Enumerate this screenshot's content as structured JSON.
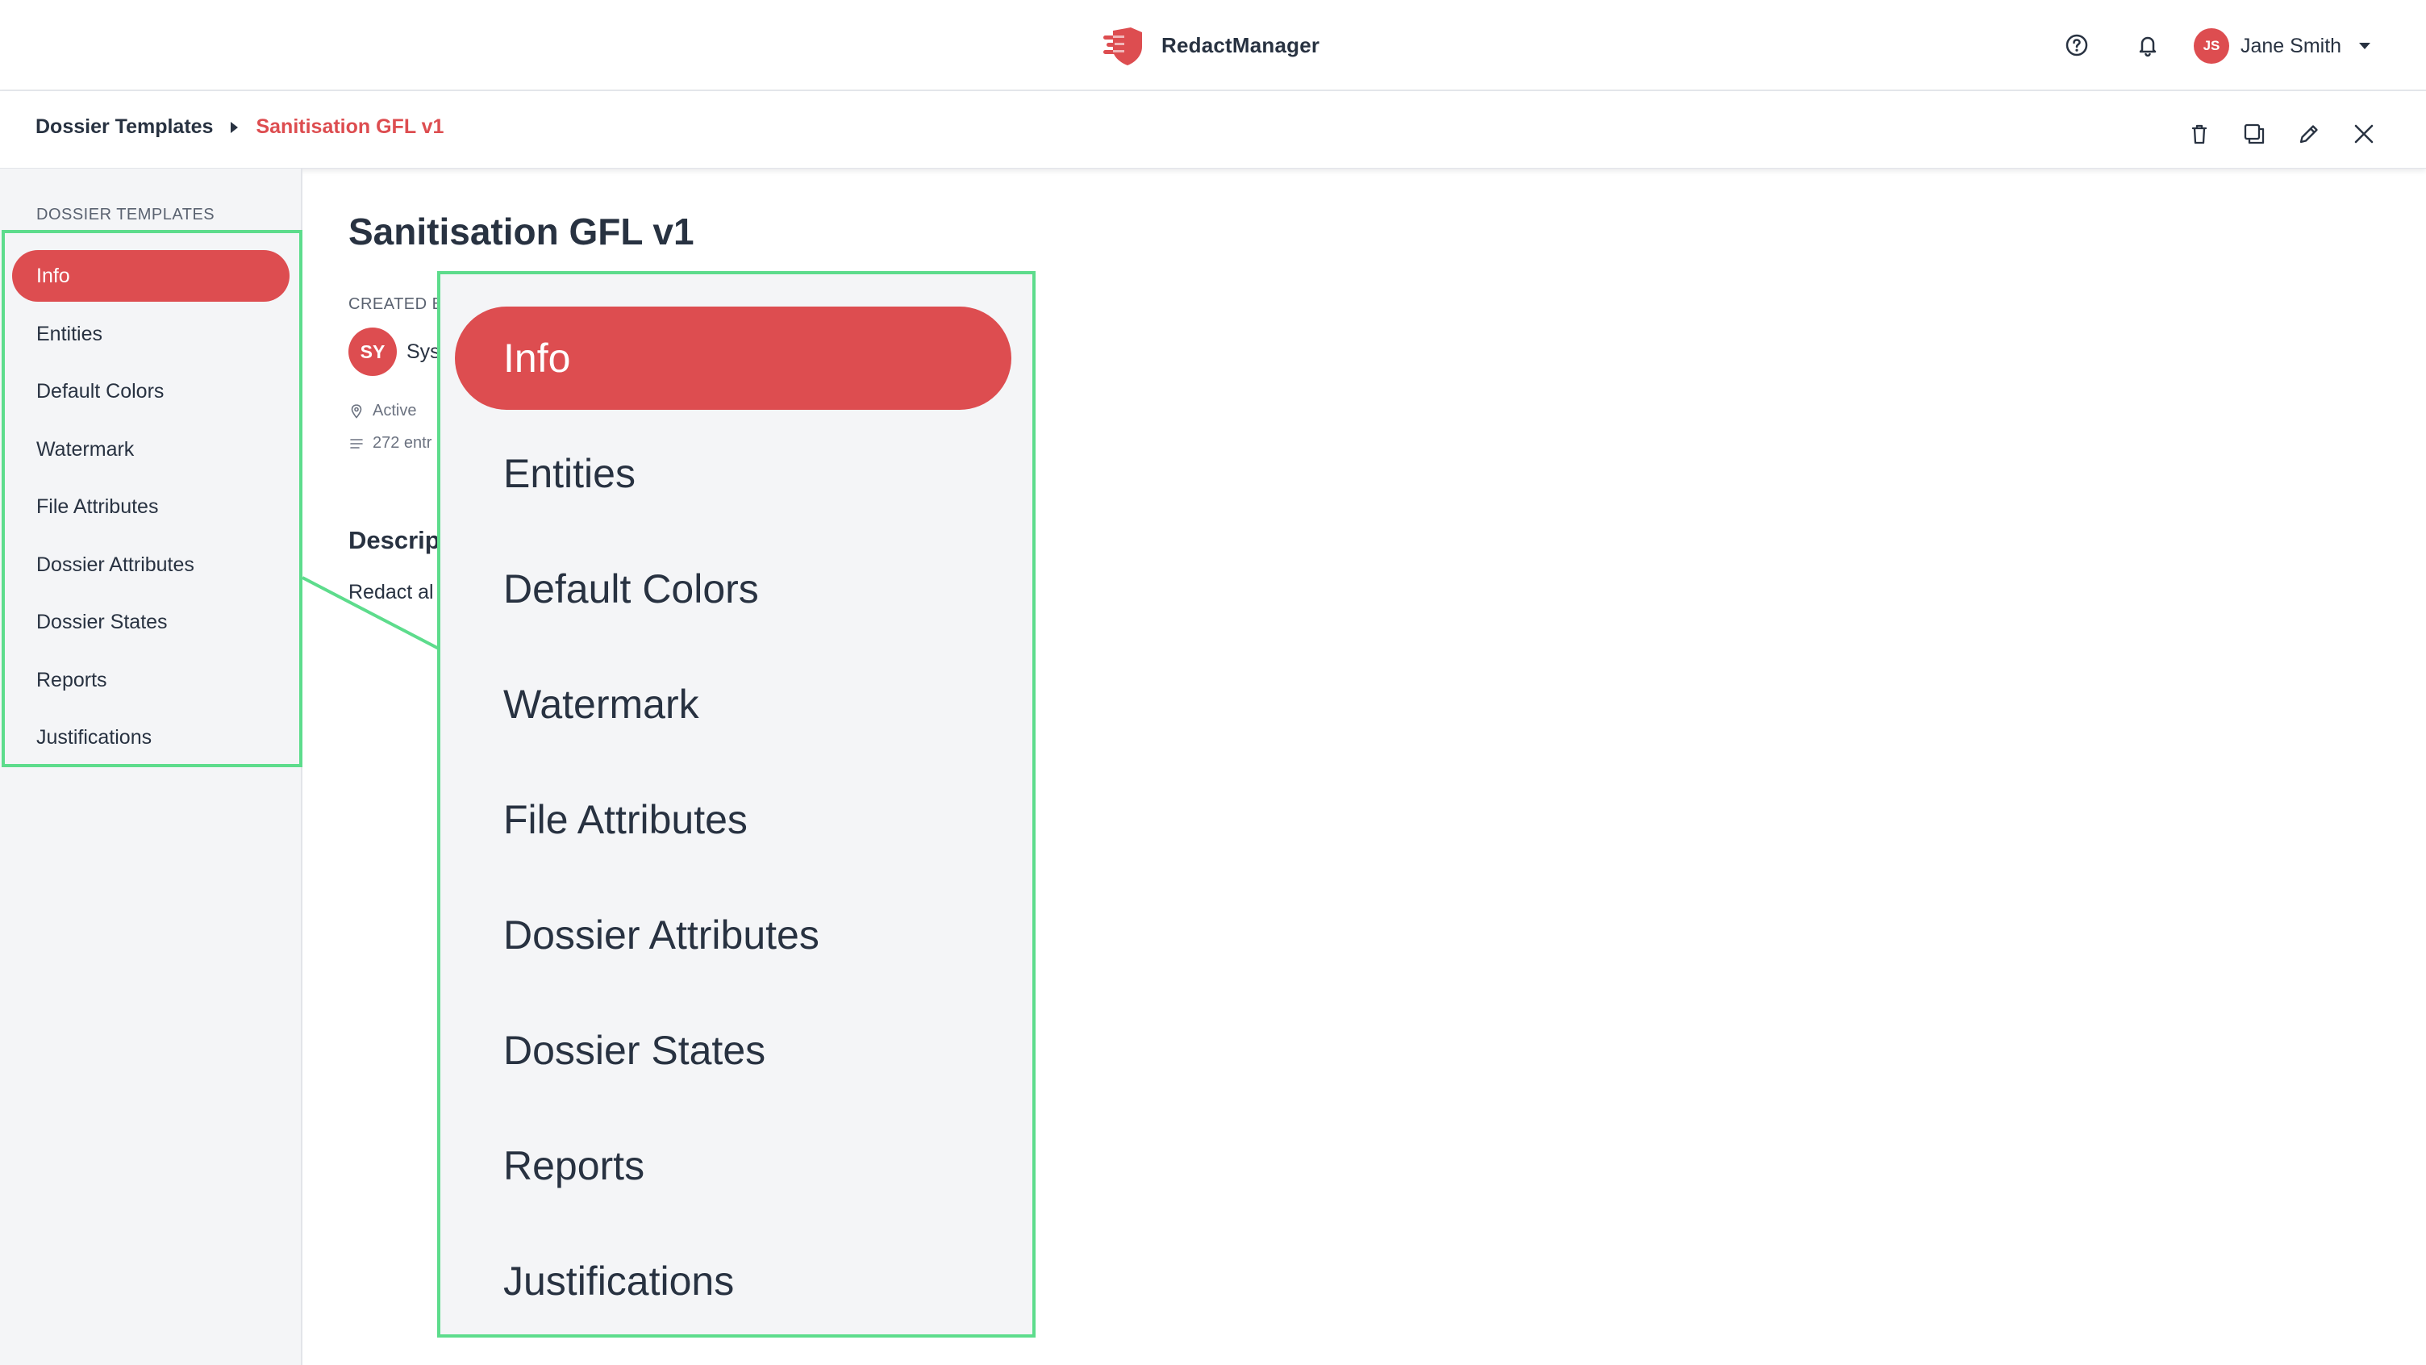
{
  "app": {
    "name": "RedactManager"
  },
  "user": {
    "initials": "JS",
    "name": "Jane Smith"
  },
  "breadcrumb": {
    "root": "Dossier Templates",
    "current": "Sanitisation GFL v1"
  },
  "sidebar": {
    "title": "DOSSIER TEMPLATES",
    "active_index": 0,
    "items": [
      {
        "label": "Info"
      },
      {
        "label": "Entities"
      },
      {
        "label": "Default Colors"
      },
      {
        "label": "Watermark"
      },
      {
        "label": "File Attributes"
      },
      {
        "label": "Dossier Attributes"
      },
      {
        "label": "Dossier States"
      },
      {
        "label": "Reports"
      },
      {
        "label": "Justifications"
      }
    ]
  },
  "main": {
    "title": "Sanitisation GFL v1",
    "created_by_label": "CREATED B",
    "owner_initials": "SY",
    "owner_name_visible": "Sys",
    "status": "Active",
    "entries": "272 entr",
    "description_heading": "Descrip",
    "description_text": "Redact al"
  },
  "colors": {
    "accent": "#dd4d50",
    "callout_border": "#5ddc8c",
    "text": "#283241",
    "sidebar_bg": "#f4f5f7"
  },
  "icons": [
    "logo-shield-icon",
    "help-icon",
    "bell-icon",
    "delete-icon",
    "duplicate-icon",
    "edit-icon",
    "close-icon",
    "pin-icon",
    "list-icon"
  ]
}
